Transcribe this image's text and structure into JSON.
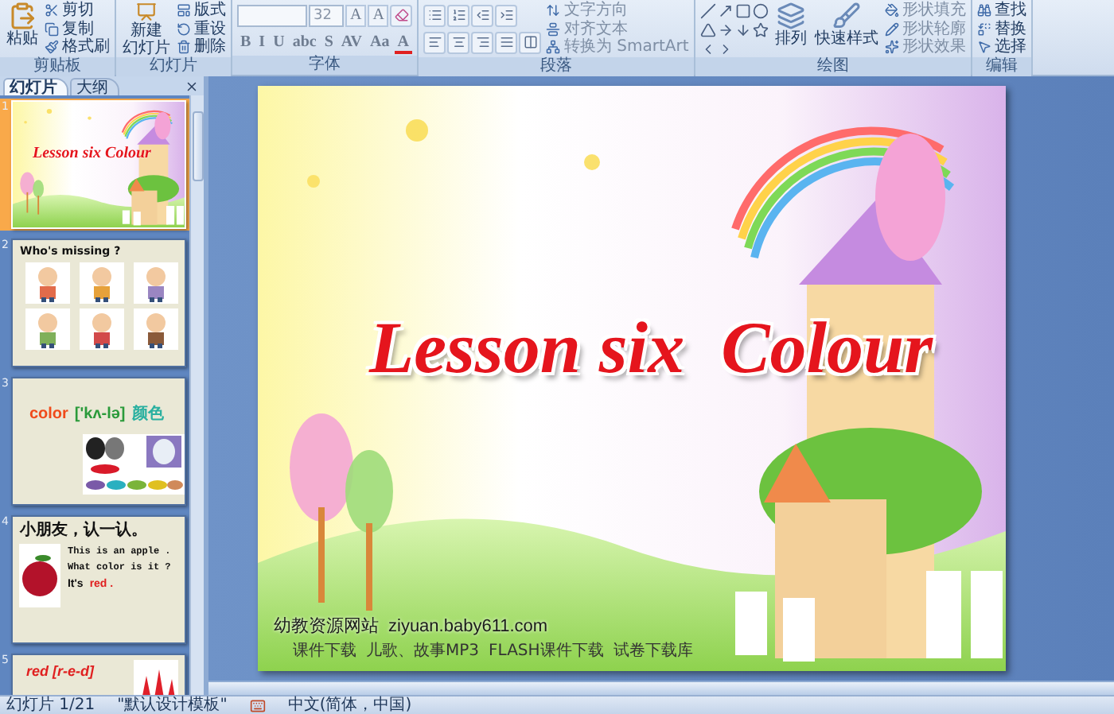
{
  "ribbon": {
    "groups": [
      {
        "kind": "clipboard",
        "label": "剪贴板",
        "large": [
          "粘贴"
        ],
        "small": [
          "剪切",
          "复制",
          "格式刷"
        ]
      },
      {
        "kind": "slides",
        "label": "幻灯片",
        "large": [
          "新建",
          "幻灯片"
        ],
        "small": [
          "版式",
          "重设",
          "删除"
        ]
      },
      {
        "kind": "font",
        "label": "字体",
        "size": "32",
        "size_buttons": [
          "A",
          "A"
        ],
        "format_buttons": [
          "B",
          "I",
          "U",
          "abc",
          "S",
          "AV",
          "Aa",
          "A"
        ]
      },
      {
        "kind": "paragraph",
        "label": "段落",
        "small": [
          "文字方向",
          "对齐文本",
          "转换为 SmartArt"
        ]
      },
      {
        "kind": "drawing",
        "label": "绘图",
        "large": [
          "排列",
          "快速样式"
        ],
        "small": [
          "形状填充",
          "形状轮廓",
          "形状效果"
        ]
      },
      {
        "kind": "editing",
        "label": "编辑",
        "small": [
          "查找",
          "替换",
          "选择"
        ]
      }
    ]
  },
  "panel": {
    "tabs": [
      {
        "label": "幻灯片",
        "selected": true
      },
      {
        "label": "大纲",
        "selected": false
      }
    ]
  },
  "slides": [
    {
      "number": "1",
      "selected": true,
      "kind": "title",
      "title": "Lesson six Colour"
    },
    {
      "number": "2",
      "selected": false,
      "kind": "gallery",
      "heading": "Who's missing ?"
    },
    {
      "number": "3",
      "selected": false,
      "kind": "vocab",
      "word": "color",
      "phonetic": "['kʌ-lə]",
      "meaning": "颜色"
    },
    {
      "number": "4",
      "selected": false,
      "kind": "dialog",
      "heading": "小朋友，认一认。",
      "lines": [
        "This is an apple .",
        "What color is it ?"
      ],
      "answer_lead": "It's",
      "answer_word": "red ."
    },
    {
      "number": "5",
      "selected": false,
      "kind": "heading",
      "heading": "red [r-e-d]"
    }
  ],
  "slide": {
    "title": "Lesson six  Colour",
    "site": "幼教资源网站",
    "url": "ziyuan.baby611.com",
    "links": [
      "课件下载",
      "儿歌、故事MP3",
      "FLASH课件下载",
      "试卷下载库"
    ]
  },
  "status_bar": {
    "slide": "幻灯片 1/21",
    "theme": "\"默认设计模板\"",
    "language": "中文(简体，中国)"
  }
}
